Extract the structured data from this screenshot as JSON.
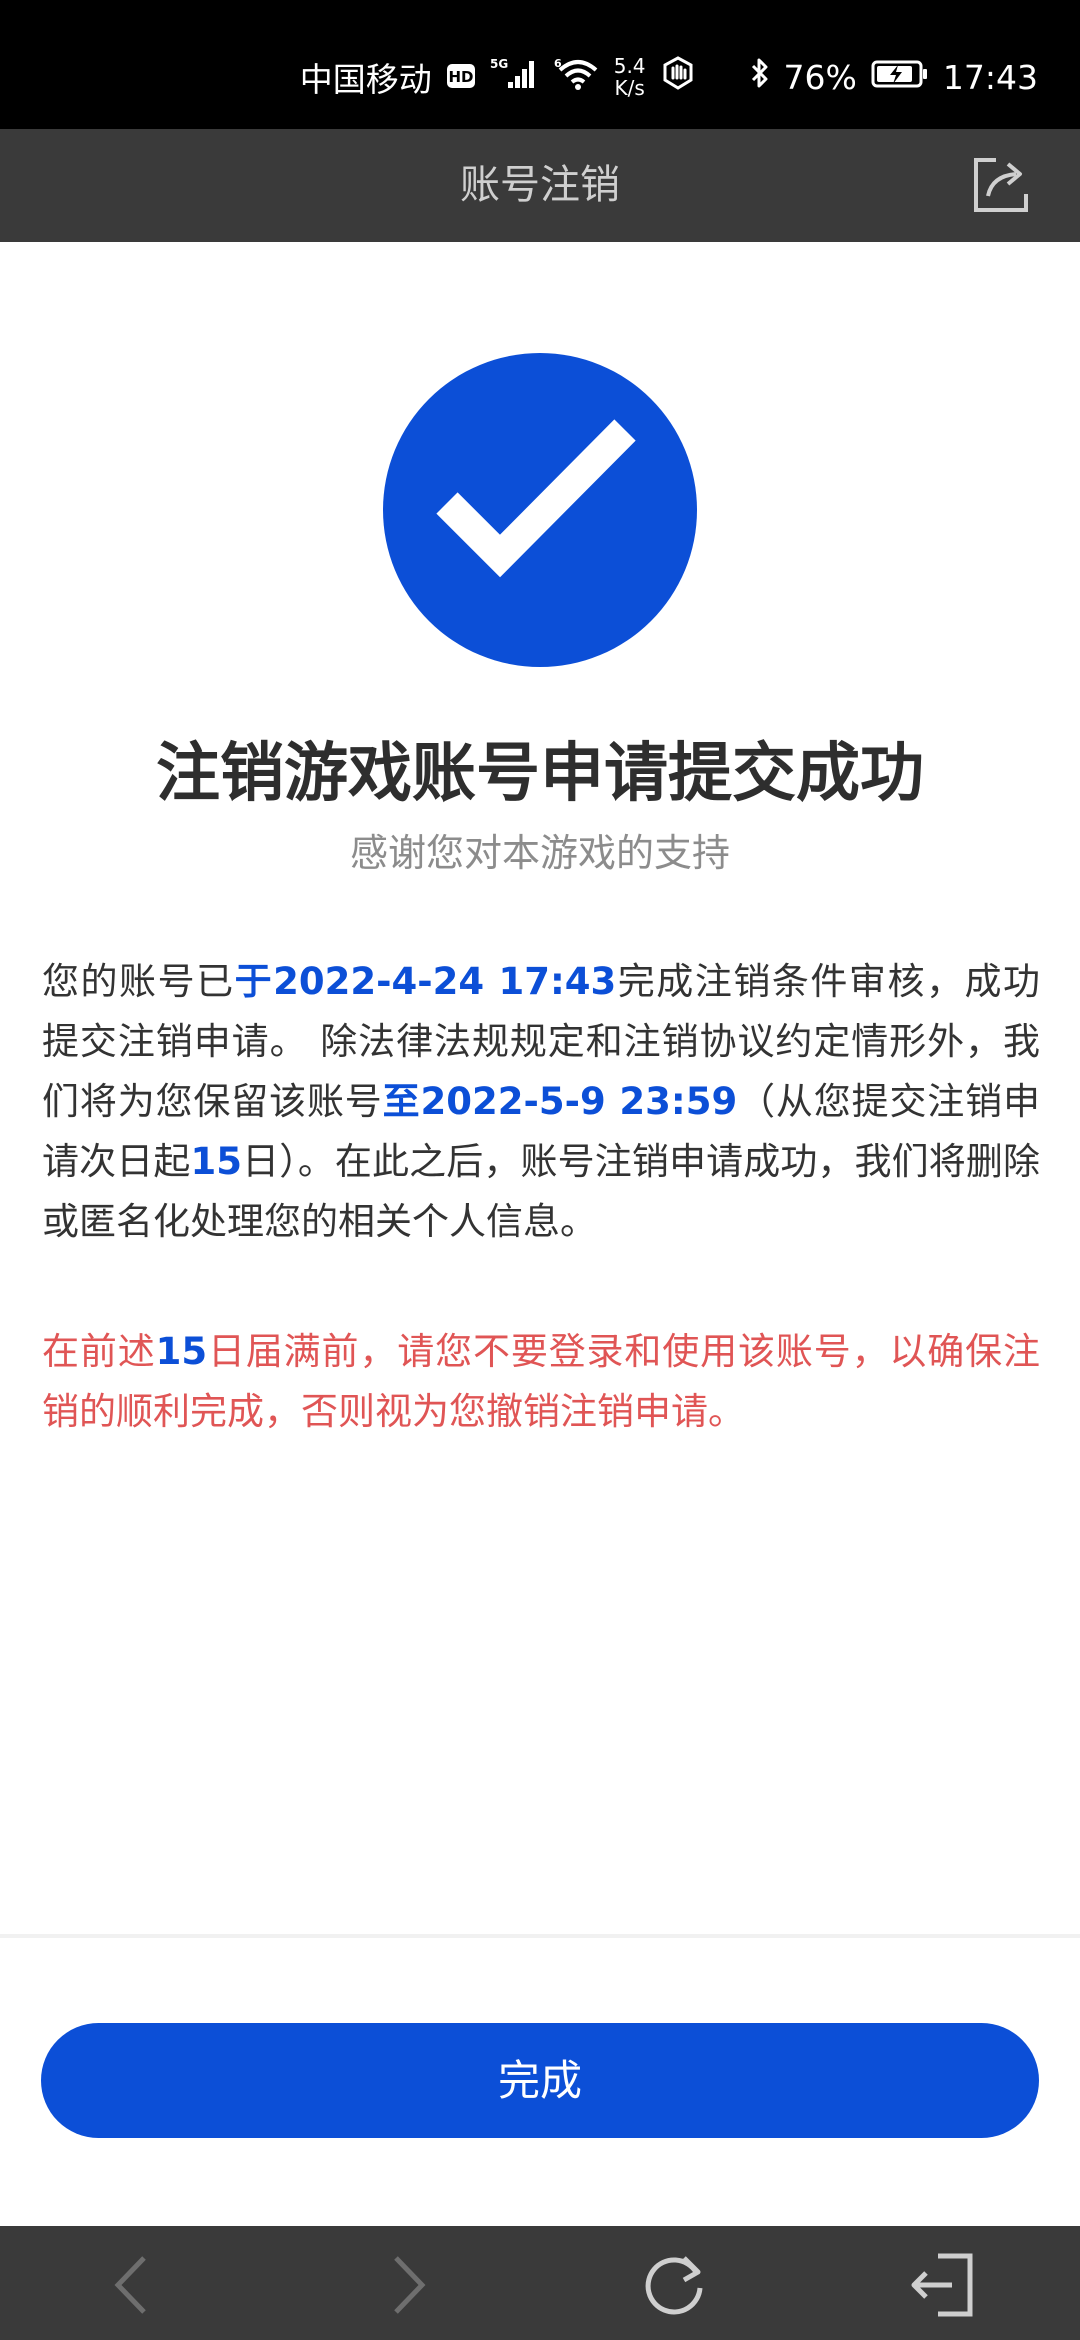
{
  "status_bar": {
    "carrier": "中国移动",
    "hd_badge": "HD",
    "signal_label": "5G",
    "wifi_label": "6",
    "speed_value": "5.4",
    "speed_unit": "K/s",
    "battery_percent": "76%",
    "time": "17:43",
    "icons": [
      "hd-icon",
      "signal-icon",
      "wifi-icon",
      "hand-icon",
      "bluetooth-icon",
      "battery-charging-icon"
    ]
  },
  "header": {
    "title": "账号注销",
    "share_icon": "share-icon"
  },
  "success": {
    "icon": "check-circle-icon",
    "title": "注销游戏账号申请提交成功",
    "subtitle": "感谢您对本游戏的支持"
  },
  "description": {
    "p1_a": "您的账号已",
    "p1_time": "于2022-4-24 17:43",
    "p1_b": "完成注销条件审核，成功提交注销申请。 除法律法规规定和注销协议约定情形外，我们将为您保留该账号",
    "p1_until": "至2022-5-9 23:59",
    "p1_c": "（从您提交注销申请次日起",
    "p1_days": "15",
    "p1_d": "日）。在此之后，账号注销申请成功，我们将删除或匿名化处理您的相关个人信息。"
  },
  "warning": {
    "a": "在前述",
    "days": "15",
    "b": "日届满前，请您不要登录和使用该账号，以确保注销的顺利完成，否则视为您撤销注销申请。"
  },
  "done_button": {
    "label": "完成"
  },
  "bottom_nav": {
    "icons": [
      "back-icon",
      "forward-icon",
      "refresh-icon",
      "exit-icon"
    ]
  },
  "colors": {
    "accent": "#0c4fd7",
    "warning": "#e05555",
    "header_bg": "#3a3a3a",
    "status_bg": "#000000"
  }
}
